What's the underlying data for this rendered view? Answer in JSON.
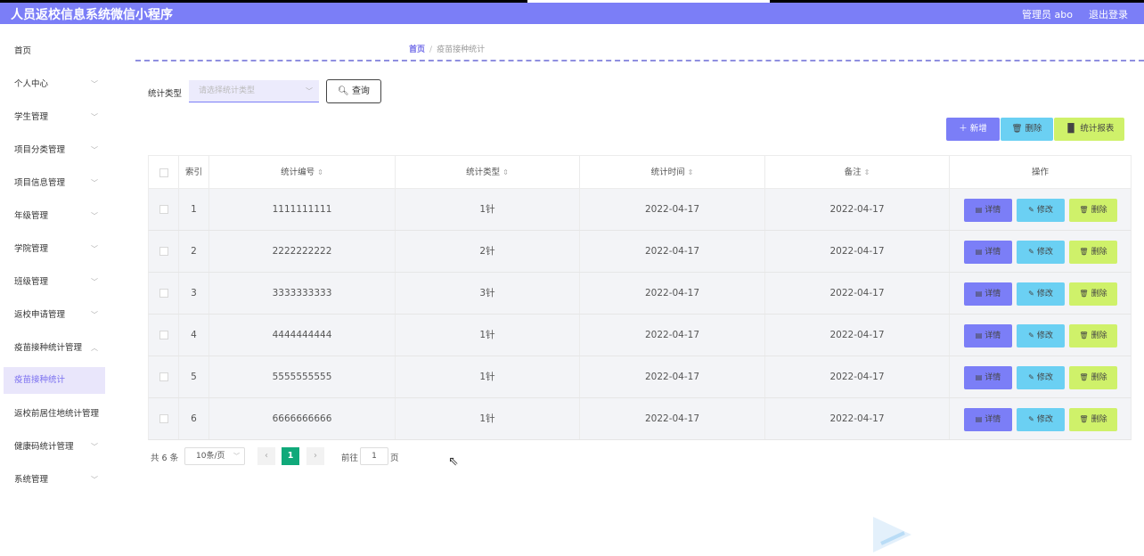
{
  "app": {
    "title": "人员返校信息系统微信小程序",
    "user": "管理员 abo",
    "logout": "退出登录"
  },
  "sidebar": {
    "items": [
      {
        "label": "首页"
      },
      {
        "label": "个人中心"
      },
      {
        "label": "学生管理"
      },
      {
        "label": "项目分类管理"
      },
      {
        "label": "项目信息管理"
      },
      {
        "label": "年级管理"
      },
      {
        "label": "学院管理"
      },
      {
        "label": "班级管理"
      },
      {
        "label": "返校申请管理"
      },
      {
        "label": "疫苗接种统计管理"
      },
      {
        "label": "疫苗接种统计"
      },
      {
        "label": "返校前居住地统计管理"
      },
      {
        "label": "健康码统计管理"
      },
      {
        "label": "系统管理"
      }
    ]
  },
  "breadcrumb": {
    "home": "首页",
    "sep": "/",
    "current": "疫苗接种统计"
  },
  "filter": {
    "label": "统计类型",
    "placeholder": "请选择统计类型",
    "query": "查询"
  },
  "actions": {
    "add": "新增",
    "delete": "删除",
    "report": "统计报表"
  },
  "table": {
    "headers": {
      "index": "索引",
      "code": "统计编号",
      "type": "统计类型",
      "time": "统计时间",
      "note": "备注",
      "op": "操作"
    },
    "op_labels": {
      "detail": "详情",
      "edit": "修改",
      "delete": "删除"
    },
    "rows": [
      {
        "index": "1",
        "code": "1111111111",
        "type": "1针",
        "time": "2022-04-17",
        "note": "2022-04-17"
      },
      {
        "index": "2",
        "code": "2222222222",
        "type": "2针",
        "time": "2022-04-17",
        "note": "2022-04-17"
      },
      {
        "index": "3",
        "code": "3333333333",
        "type": "3针",
        "time": "2022-04-17",
        "note": "2022-04-17"
      },
      {
        "index": "4",
        "code": "4444444444",
        "type": "1针",
        "time": "2022-04-17",
        "note": "2022-04-17"
      },
      {
        "index": "5",
        "code": "5555555555",
        "type": "1针",
        "time": "2022-04-17",
        "note": "2022-04-17"
      },
      {
        "index": "6",
        "code": "6666666666",
        "type": "1针",
        "time": "2022-04-17",
        "note": "2022-04-17"
      }
    ]
  },
  "pagination": {
    "total": "共 6 条",
    "page_size": "10条/页",
    "current": "1",
    "goto": "前往",
    "goto_value": "1",
    "page_unit": "页"
  },
  "colors": {
    "accent": "#7b7ef7",
    "cyan": "#6bd0f3",
    "lime": "#cff16a",
    "page_active": "#10a97a"
  }
}
